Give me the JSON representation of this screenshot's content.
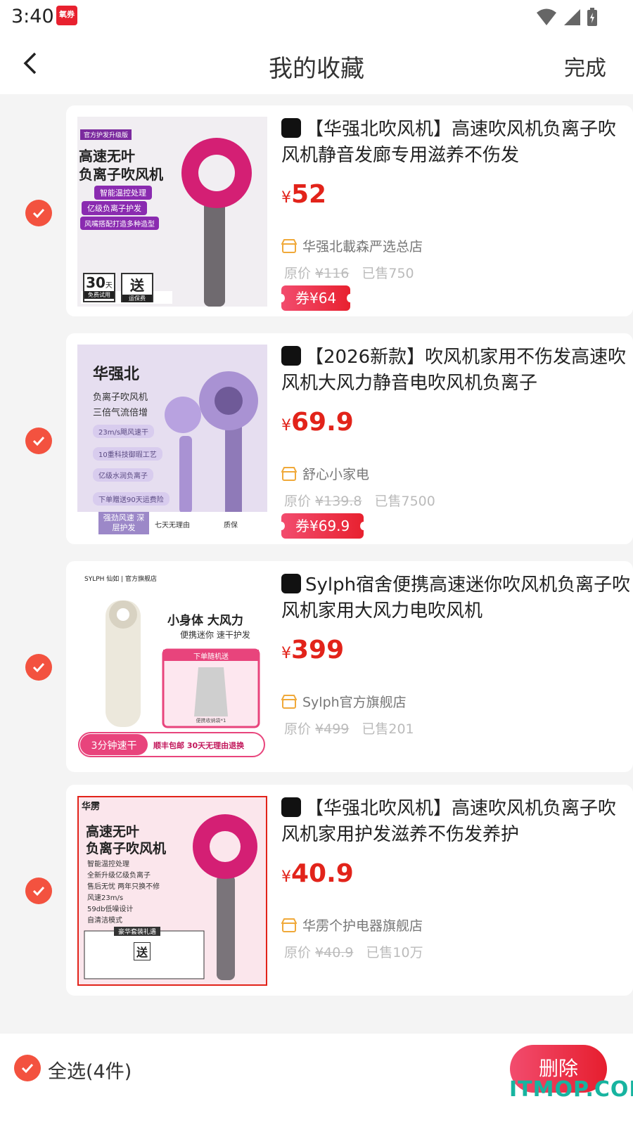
{
  "status_bar": {
    "time": "3:40",
    "app_badge": "氧券"
  },
  "header": {
    "title": "我的收藏",
    "done_label": "完成"
  },
  "items": [
    {
      "title": "【华强北吹风机】高速吹风机负离子吹风机静音发廊专用滋养不伤发",
      "price": "52",
      "yen": "¥",
      "shop": "华强北載森严选总店",
      "orig_label": "原价",
      "orig_price": "¥116",
      "sold": "已售750",
      "coupon": "券¥64",
      "thumb": {
        "badge": "官方护发升级版",
        "headline1": "高速无叶",
        "headline2": "负离子吹风机",
        "tags": [
          "智能温控处理",
          "亿级负离子护发",
          "风嘴搭配打造多种造型"
        ],
        "days": "30",
        "days_unit": "天",
        "days_sub": "免费试用",
        "gift": "送",
        "gift_sub": "运保费"
      }
    },
    {
      "title": "【2026新款】吹风机家用不伤发高速吹风机大风力静音电吹风机负离子",
      "price": "69.9",
      "yen": "¥",
      "shop": "舒心小家电",
      "orig_label": "原价",
      "orig_price": "¥139.8",
      "sold": "已售7500",
      "coupon": "券¥69.9",
      "thumb": {
        "headline1": "华强北",
        "headline2": "负离子吹风机",
        "headline3": "三倍气流倍增",
        "tags": [
          "23m/s飓风速干",
          "10重科技御瑕工艺",
          "亿级水润负离子",
          "下单赠送90天运费险"
        ],
        "footer_left": "强劲风速 深层护发",
        "footer_mid": "七天无理由",
        "footer_right": "质保"
      }
    },
    {
      "title": "Sylph宿舍便携高速迷你吹风机负离子吹风机家用大风力电吹风机",
      "price": "399",
      "yen": "¥",
      "shop": "Sylph官方旗舰店",
      "orig_label": "原价",
      "orig_price": "¥499",
      "sold": "已售201",
      "thumb": {
        "brand": "SYLPH 仙如 | 官方旗舰店",
        "headline1": "小身体 大风力",
        "headline2": "便携迷你 速干护发",
        "gift_title": "下单随机送",
        "gift_caption": "便携收纳袋*1",
        "bottom_left": "3分钟速干",
        "bottom_right": "顺丰包邮 30天无理由退换"
      }
    },
    {
      "title": "【华强北吹风机】高速吹风机负离子吹风机家用护发滋养不伤发养护",
      "price": "40.9",
      "yen": "¥",
      "shop": "华雳个护电器旗舰店",
      "orig_label": "原价",
      "orig_price": "¥40.9",
      "sold": "已售10万",
      "thumb": {
        "logo": "华雳",
        "headline1": "高速无叶",
        "headline2": "负离子吹风机",
        "features": [
          "智能温控处理",
          "全新升级亿级负离子",
          "售后无忧 两年只换不修",
          "风速23m/s",
          "59db低噪设计",
          "自清洁模式"
        ],
        "gift_banner": "豪华套装礼遇",
        "gift": "送"
      }
    }
  ],
  "bottom_bar": {
    "select_all_label": "全选(4件)",
    "delete_label": "删除"
  },
  "watermark": "ITMOP.COM",
  "colors": {
    "accent": "#e2231a",
    "check": "#f3523f",
    "coupon_start": "#f24c6e",
    "coupon_end": "#e8212f"
  }
}
